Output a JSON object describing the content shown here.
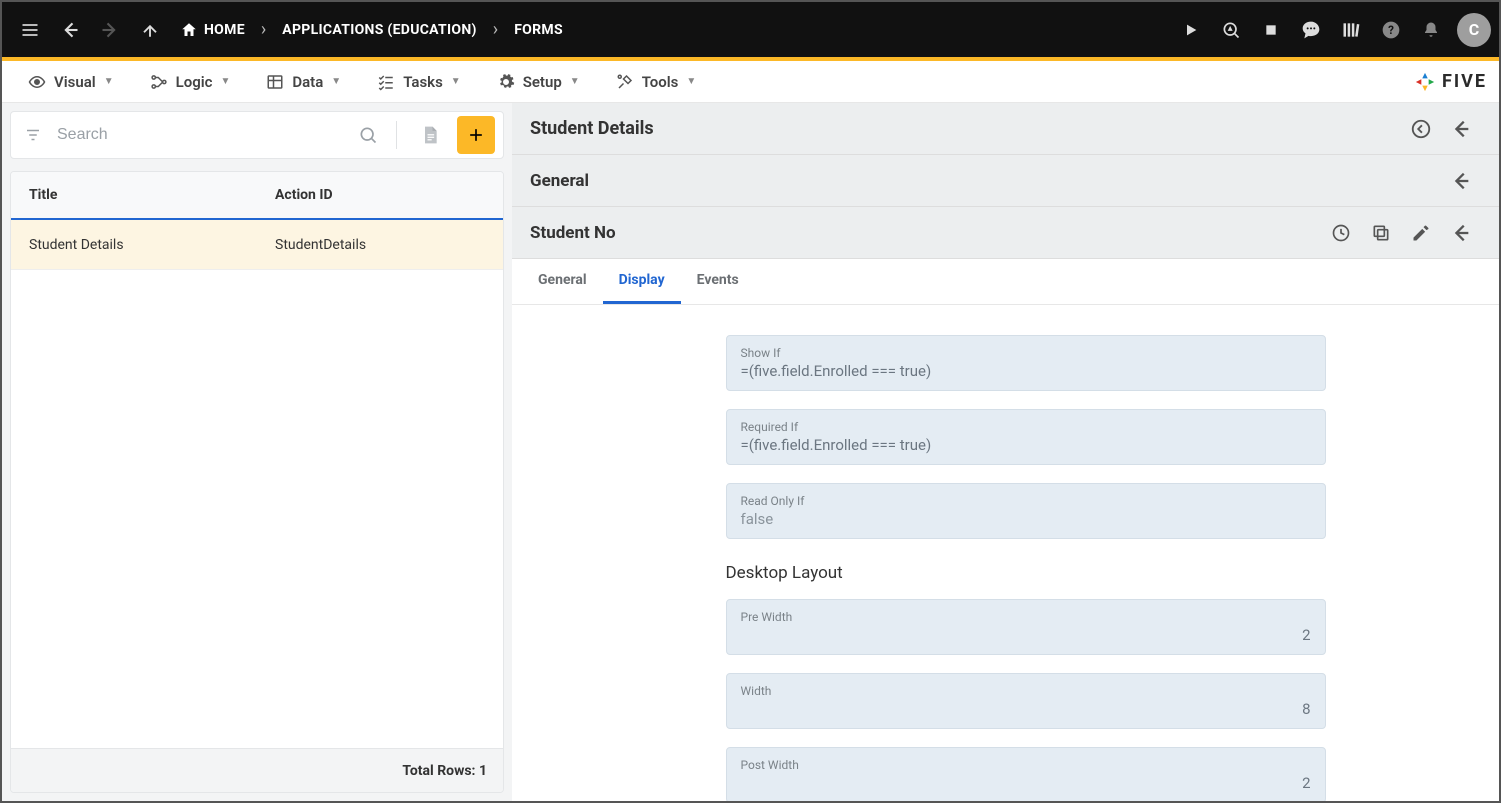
{
  "topbar": {
    "breadcrumbs": [
      {
        "label": "HOME"
      },
      {
        "label": "APPLICATIONS (EDUCATION)"
      },
      {
        "label": "FORMS"
      }
    ],
    "avatar_letter": "C"
  },
  "menubar": {
    "items": [
      {
        "label": "Visual"
      },
      {
        "label": "Logic"
      },
      {
        "label": "Data"
      },
      {
        "label": "Tasks"
      },
      {
        "label": "Setup"
      },
      {
        "label": "Tools"
      }
    ],
    "brand": "FIVE"
  },
  "left": {
    "search_placeholder": "Search",
    "headers": {
      "title": "Title",
      "action_id": "Action ID"
    },
    "rows": [
      {
        "title": "Student Details",
        "action_id": "StudentDetails"
      }
    ],
    "footer": "Total Rows: 1"
  },
  "right": {
    "header1": "Student Details",
    "header2": "General",
    "header3": "Student No",
    "tabs": [
      {
        "label": "General",
        "active": false
      },
      {
        "label": "Display",
        "active": true
      },
      {
        "label": "Events",
        "active": false
      }
    ],
    "fields": {
      "show_if": {
        "label": "Show If",
        "value": "=(five.field.Enrolled === true)"
      },
      "required_if": {
        "label": "Required If",
        "value": "=(five.field.Enrolled === true)"
      },
      "read_only_if": {
        "label": "Read Only If",
        "value": "",
        "placeholder": "false"
      }
    },
    "desktop_layout_title": "Desktop Layout",
    "layout": {
      "pre_width": {
        "label": "Pre Width",
        "value": "2"
      },
      "width": {
        "label": "Width",
        "value": "8"
      },
      "post_width": {
        "label": "Post Width",
        "value": "2"
      }
    }
  }
}
